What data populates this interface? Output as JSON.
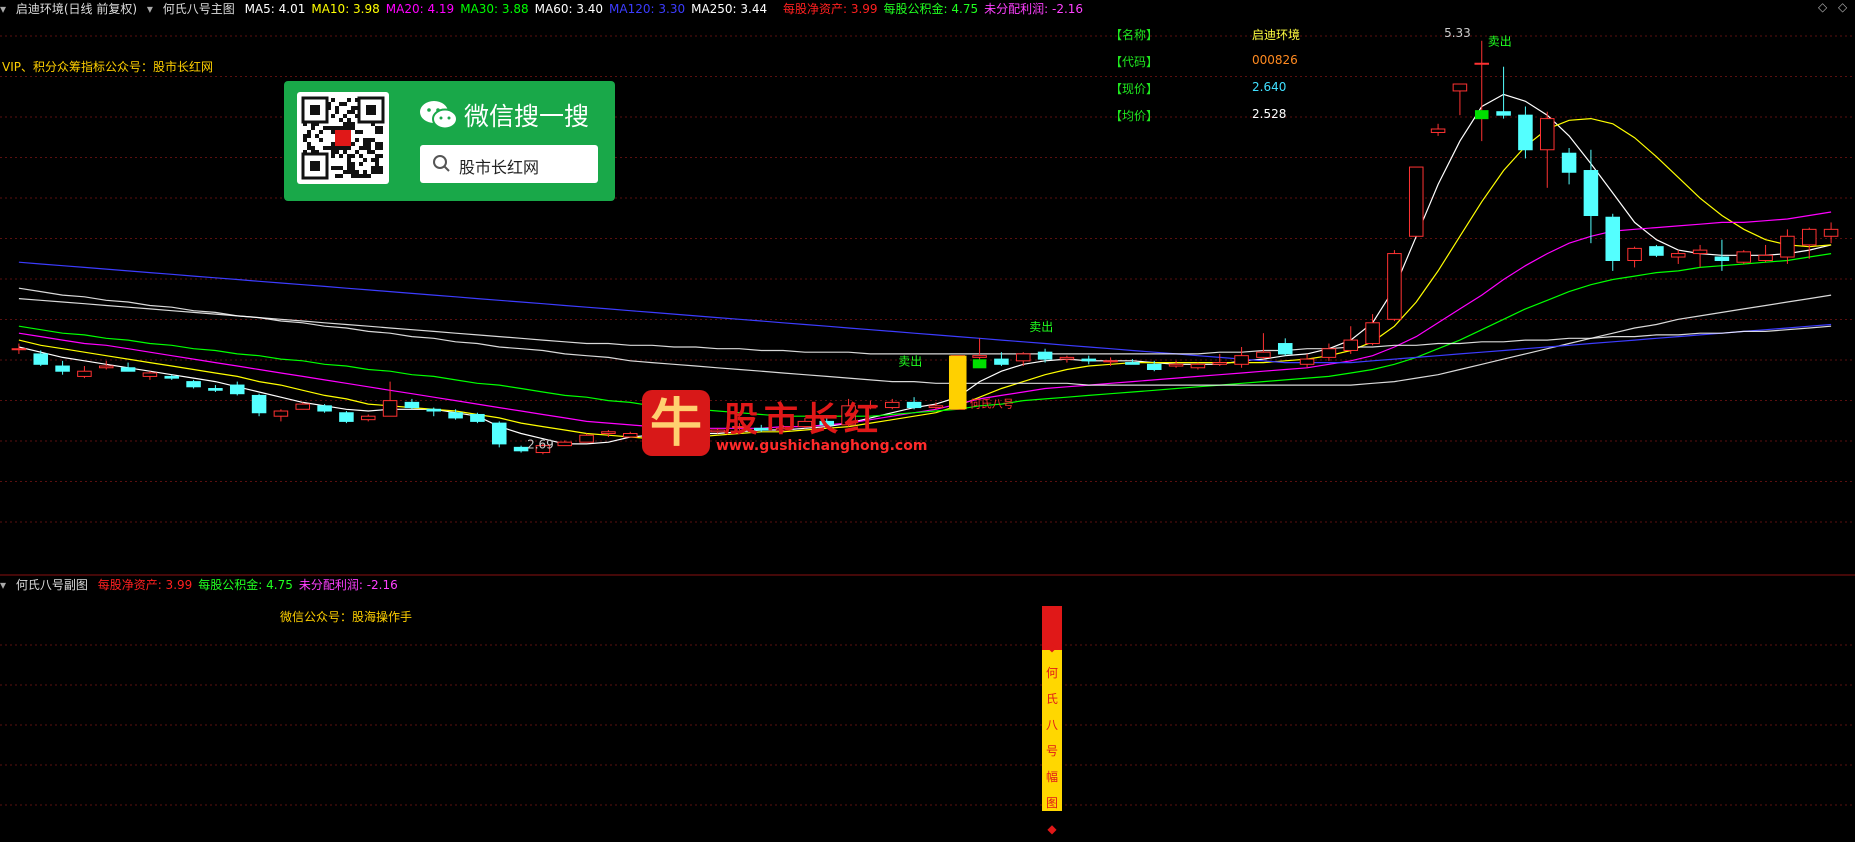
{
  "header": {
    "stock_title": "启迪环境(日线 前复权)",
    "indicator_name": "何氏八号主图",
    "ma_items": [
      {
        "label": "MA5: 4.01",
        "color": "#ffffff"
      },
      {
        "label": "MA10: 3.98",
        "color": "#ffff00"
      },
      {
        "label": "MA20: 4.19",
        "color": "#ff00ff"
      },
      {
        "label": "MA30: 3.88",
        "color": "#00ff00"
      },
      {
        "label": "MA60: 3.40",
        "color": "#ffffff"
      },
      {
        "label": "MA120: 3.30",
        "color": "#3c3cff"
      },
      {
        "label": "MA250: 3.44",
        "color": "#ffffff"
      }
    ],
    "fin_items": [
      {
        "label": "每股净资产: 3.99",
        "color": "#ff2020"
      },
      {
        "label": "每股公积金: 4.75",
        "color": "#20ff20"
      },
      {
        "label": "未分配利润: -2.16",
        "color": "#ff40ff"
      }
    ]
  },
  "vip_note": "VIP、积分众筹指标公众号：股市长红网",
  "info_panel": [
    {
      "key": "【名称】",
      "value": "启迪环境",
      "color": "#ffff40"
    },
    {
      "key": "【代码】",
      "value": "000826",
      "color": "#ff8a20"
    },
    {
      "key": "【现价】",
      "value": "2.640",
      "color": "#40e0ff"
    },
    {
      "key": "【均价】",
      "value": "2.528",
      "color": "#ffffff"
    }
  ],
  "wechat_box": {
    "title": "微信搜一搜",
    "search_text": "股市长红网"
  },
  "watermark": {
    "char": "牛",
    "name": "股市长红",
    "url": "www.gushichanghong.com"
  },
  "sub_chart": {
    "title": "何氏八号副图",
    "fin_items": [
      {
        "label": "每股净资产: 3.99",
        "color": "#ff2020"
      },
      {
        "label": "每股公积金: 4.75",
        "color": "#20ff20"
      },
      {
        "label": "未分配利润: -2.16",
        "color": "#ff40ff"
      }
    ],
    "note": "微信公众号：股海操作手",
    "vertical_text": [
      "◆",
      "何",
      "氏",
      "八",
      "号",
      "幅",
      "图",
      "◆"
    ]
  },
  "chart_data": {
    "type": "candlestick",
    "ylim": [
      2.3,
      5.45
    ],
    "colors": {
      "up": "#ff3232",
      "down": "#54ffff",
      "ma5": "#ffffff",
      "ma10": "#ffff00",
      "ma20": "#ff00ff",
      "ma30": "#00ff00",
      "ma60": "#ffffff",
      "ma120": "#3c3cff",
      "ma250": "#ffffff"
    },
    "candles": [
      {
        "o": 3.55,
        "h": 3.58,
        "l": 3.52,
        "c": 3.55
      },
      {
        "o": 3.52,
        "h": 3.54,
        "l": 3.45,
        "c": 3.46
      },
      {
        "o": 3.45,
        "h": 3.48,
        "l": 3.4,
        "c": 3.42
      },
      {
        "o": 3.39,
        "h": 3.45,
        "l": 3.38,
        "c": 3.42
      },
      {
        "o": 3.44,
        "h": 3.48,
        "l": 3.43,
        "c": 3.45
      },
      {
        "o": 3.44,
        "h": 3.47,
        "l": 3.42,
        "c": 3.42
      },
      {
        "o": 3.39,
        "h": 3.42,
        "l": 3.37,
        "c": 3.41
      },
      {
        "o": 3.39,
        "h": 3.4,
        "l": 3.37,
        "c": 3.38
      },
      {
        "o": 3.36,
        "h": 3.37,
        "l": 3.32,
        "c": 3.33
      },
      {
        "o": 3.32,
        "h": 3.34,
        "l": 3.3,
        "c": 3.31
      },
      {
        "o": 3.34,
        "h": 3.36,
        "l": 3.28,
        "c": 3.29
      },
      {
        "o": 3.28,
        "h": 3.29,
        "l": 3.16,
        "c": 3.18
      },
      {
        "o": 3.16,
        "h": 3.2,
        "l": 3.13,
        "c": 3.19
      },
      {
        "o": 3.2,
        "h": 3.24,
        "l": 3.2,
        "c": 3.23
      },
      {
        "o": 3.22,
        "h": 3.23,
        "l": 3.18,
        "c": 3.19
      },
      {
        "o": 3.18,
        "h": 3.19,
        "l": 3.12,
        "c": 3.13
      },
      {
        "o": 3.14,
        "h": 3.17,
        "l": 3.13,
        "c": 3.16
      },
      {
        "o": 3.16,
        "h": 3.36,
        "l": 3.16,
        "c": 3.25
      },
      {
        "o": 3.24,
        "h": 3.26,
        "l": 3.2,
        "c": 3.21
      },
      {
        "o": 3.2,
        "h": 3.21,
        "l": 3.16,
        "c": 3.19
      },
      {
        "o": 3.18,
        "h": 3.2,
        "l": 3.14,
        "c": 3.15
      },
      {
        "o": 3.17,
        "h": 3.18,
        "l": 3.12,
        "c": 3.13
      },
      {
        "o": 3.12,
        "h": 3.13,
        "l": 2.98,
        "c": 3.0
      },
      {
        "o": 2.98,
        "h": 2.99,
        "l": 2.95,
        "c": 2.96
      },
      {
        "o": 2.95,
        "h": 3.0,
        "l": 2.94,
        "c": 2.99
      },
      {
        "o": 2.99,
        "h": 3.02,
        "l": 2.99,
        "c": 3.01
      },
      {
        "o": 3.01,
        "h": 3.06,
        "l": 3.01,
        "c": 3.05
      },
      {
        "o": 3.06,
        "h": 3.08,
        "l": 3.04,
        "c": 3.07
      },
      {
        "o": 3.04,
        "h": 3.07,
        "l": 3.04,
        "c": 3.06
      },
      {
        "o": 3.04,
        "h": 3.06,
        "l": 3.03,
        "c": 3.05
      },
      {
        "o": 3.06,
        "h": 3.08,
        "l": 3.05,
        "c": 3.06
      },
      {
        "o": 3.06,
        "h": 3.1,
        "l": 3.06,
        "c": 3.08
      },
      {
        "o": 3.07,
        "h": 3.09,
        "l": 3.06,
        "c": 3.08
      },
      {
        "o": 3.1,
        "h": 3.12,
        "l": 3.08,
        "c": 3.1
      },
      {
        "o": 3.09,
        "h": 3.11,
        "l": 3.07,
        "c": 3.08
      },
      {
        "o": 3.08,
        "h": 3.11,
        "l": 3.07,
        "c": 3.09
      },
      {
        "o": 3.1,
        "h": 3.15,
        "l": 3.09,
        "c": 3.13
      },
      {
        "o": 3.13,
        "h": 3.15,
        "l": 3.1,
        "c": 3.11
      },
      {
        "o": 3.11,
        "h": 3.26,
        "l": 3.1,
        "c": 3.22
      },
      {
        "o": 3.22,
        "h": 3.25,
        "l": 3.2,
        "c": 3.22
      },
      {
        "o": 3.21,
        "h": 3.26,
        "l": 3.2,
        "c": 3.24
      },
      {
        "o": 3.24,
        "h": 3.27,
        "l": 3.2,
        "c": 3.21
      },
      {
        "o": 3.21,
        "h": 3.24,
        "l": 3.2,
        "c": 3.22
      },
      {
        "o": 3.2,
        "h": 3.51,
        "l": 3.2,
        "c": 3.51
      },
      {
        "o": 3.5,
        "h": 3.61,
        "l": 3.44,
        "c": 3.51
      },
      {
        "o": 3.49,
        "h": 3.53,
        "l": 3.45,
        "c": 3.46
      },
      {
        "o": 3.48,
        "h": 3.53,
        "l": 3.45,
        "c": 3.52
      },
      {
        "o": 3.53,
        "h": 3.55,
        "l": 3.47,
        "c": 3.49
      },
      {
        "o": 3.49,
        "h": 3.51,
        "l": 3.47,
        "c": 3.5
      },
      {
        "o": 3.49,
        "h": 3.51,
        "l": 3.46,
        "c": 3.48
      },
      {
        "o": 3.48,
        "h": 3.5,
        "l": 3.45,
        "c": 3.48
      },
      {
        "o": 3.47,
        "h": 3.49,
        "l": 3.46,
        "c": 3.46
      },
      {
        "o": 3.46,
        "h": 3.48,
        "l": 3.42,
        "c": 3.43
      },
      {
        "o": 3.45,
        "h": 3.48,
        "l": 3.44,
        "c": 3.46
      },
      {
        "o": 3.44,
        "h": 3.47,
        "l": 3.43,
        "c": 3.46
      },
      {
        "o": 3.46,
        "h": 3.52,
        "l": 3.45,
        "c": 3.47
      },
      {
        "o": 3.46,
        "h": 3.56,
        "l": 3.44,
        "c": 3.51
      },
      {
        "o": 3.5,
        "h": 3.64,
        "l": 3.49,
        "c": 3.53
      },
      {
        "o": 3.58,
        "h": 3.61,
        "l": 3.51,
        "c": 3.52
      },
      {
        "o": 3.46,
        "h": 3.52,
        "l": 3.44,
        "c": 3.49
      },
      {
        "o": 3.5,
        "h": 3.58,
        "l": 3.48,
        "c": 3.55
      },
      {
        "o": 3.54,
        "h": 3.68,
        "l": 3.52,
        "c": 3.6
      },
      {
        "o": 3.58,
        "h": 3.75,
        "l": 3.57,
        "c": 3.7
      },
      {
        "o": 3.72,
        "h": 4.12,
        "l": 3.71,
        "c": 4.1
      },
      {
        "o": 4.2,
        "h": 4.6,
        "l": 4.2,
        "c": 4.6
      },
      {
        "o": 4.8,
        "h": 4.85,
        "l": 4.78,
        "c": 4.82
      },
      {
        "o": 5.04,
        "h": 5.08,
        "l": 4.9,
        "c": 5.08
      },
      {
        "o": 5.2,
        "h": 5.33,
        "l": 4.75,
        "c": 5.2
      },
      {
        "o": 4.92,
        "h": 5.18,
        "l": 4.88,
        "c": 4.9
      },
      {
        "o": 4.9,
        "h": 4.95,
        "l": 4.65,
        "c": 4.7
      },
      {
        "o": 4.7,
        "h": 4.92,
        "l": 4.48,
        "c": 4.88
      },
      {
        "o": 4.68,
        "h": 4.71,
        "l": 4.5,
        "c": 4.57
      },
      {
        "o": 4.58,
        "h": 4.7,
        "l": 4.16,
        "c": 4.32
      },
      {
        "o": 4.31,
        "h": 4.33,
        "l": 4.0,
        "c": 4.06
      },
      {
        "o": 4.06,
        "h": 4.14,
        "l": 4.02,
        "c": 4.13
      },
      {
        "o": 4.14,
        "h": 4.15,
        "l": 4.08,
        "c": 4.09
      },
      {
        "o": 4.08,
        "h": 4.12,
        "l": 4.04,
        "c": 4.1
      },
      {
        "o": 4.1,
        "h": 4.15,
        "l": 4.02,
        "c": 4.12
      },
      {
        "o": 4.08,
        "h": 4.18,
        "l": 4.0,
        "c": 4.06
      },
      {
        "o": 4.05,
        "h": 4.12,
        "l": 4.04,
        "c": 4.11
      },
      {
        "o": 4.06,
        "h": 4.15,
        "l": 4.05,
        "c": 4.09
      },
      {
        "o": 4.08,
        "h": 4.24,
        "l": 4.04,
        "c": 4.2
      },
      {
        "o": 4.15,
        "h": 4.25,
        "l": 4.07,
        "c": 4.24
      },
      {
        "o": 4.2,
        "h": 4.28,
        "l": 4.16,
        "c": 4.24
      }
    ],
    "ma": {
      "ma5": [
        3.56,
        3.53,
        3.5,
        3.48,
        3.46,
        3.44,
        3.42,
        3.4,
        3.38,
        3.36,
        3.33,
        3.3,
        3.27,
        3.24,
        3.22,
        3.2,
        3.19,
        3.2,
        3.2,
        3.2,
        3.18,
        3.16,
        3.1,
        3.06,
        3.03,
        3.0,
        3.0,
        3.01,
        3.04,
        3.05,
        3.06,
        3.06,
        3.06,
        3.07,
        3.08,
        3.08,
        3.09,
        3.1,
        3.12,
        3.15,
        3.18,
        3.21,
        3.23,
        3.27,
        3.36,
        3.42,
        3.46,
        3.48,
        3.49,
        3.48,
        3.48,
        3.48,
        3.47,
        3.46,
        3.46,
        3.46,
        3.48,
        3.49,
        3.51,
        3.52,
        3.55,
        3.6,
        3.7,
        3.9,
        4.2,
        4.5,
        4.75,
        4.95,
        5.02,
        4.98,
        4.9,
        4.78,
        4.62,
        4.45,
        4.28,
        4.18,
        4.12,
        4.1,
        4.09,
        4.09,
        4.09,
        4.1,
        4.12,
        4.15
      ],
      "ma10": [
        3.6,
        3.57,
        3.55,
        3.53,
        3.51,
        3.49,
        3.47,
        3.45,
        3.43,
        3.41,
        3.39,
        3.36,
        3.34,
        3.31,
        3.28,
        3.26,
        3.23,
        3.22,
        3.21,
        3.2,
        3.19,
        3.17,
        3.15,
        3.12,
        3.1,
        3.08,
        3.06,
        3.05,
        3.04,
        3.03,
        3.03,
        3.04,
        3.05,
        3.06,
        3.07,
        3.07,
        3.08,
        3.09,
        3.1,
        3.12,
        3.14,
        3.16,
        3.18,
        3.22,
        3.27,
        3.32,
        3.36,
        3.4,
        3.43,
        3.45,
        3.46,
        3.47,
        3.47,
        3.47,
        3.47,
        3.47,
        3.47,
        3.47,
        3.48,
        3.49,
        3.51,
        3.54,
        3.59,
        3.68,
        3.82,
        4.0,
        4.2,
        4.4,
        4.58,
        4.72,
        4.82,
        4.87,
        4.88,
        4.85,
        4.77,
        4.66,
        4.54,
        4.42,
        4.32,
        4.24,
        4.18,
        4.15,
        4.14,
        4.15
      ],
      "ma20": [
        3.64,
        3.62,
        3.6,
        3.58,
        3.57,
        3.55,
        3.53,
        3.51,
        3.49,
        3.47,
        3.45,
        3.43,
        3.41,
        3.39,
        3.37,
        3.35,
        3.33,
        3.31,
        3.29,
        3.27,
        3.25,
        3.23,
        3.21,
        3.19,
        3.17,
        3.15,
        3.13,
        3.12,
        3.11,
        3.1,
        3.09,
        3.09,
        3.09,
        3.09,
        3.09,
        3.1,
        3.1,
        3.11,
        3.12,
        3.14,
        3.16,
        3.18,
        3.2,
        3.23,
        3.26,
        3.28,
        3.3,
        3.32,
        3.33,
        3.34,
        3.35,
        3.36,
        3.37,
        3.38,
        3.39,
        3.4,
        3.41,
        3.42,
        3.43,
        3.44,
        3.46,
        3.48,
        3.51,
        3.56,
        3.62,
        3.7,
        3.78,
        3.86,
        3.95,
        4.03,
        4.1,
        4.16,
        4.2,
        4.23,
        4.24,
        4.25,
        4.26,
        4.27,
        4.28,
        4.28,
        4.29,
        4.3,
        4.32,
        4.34
      ],
      "ma30": [
        3.68,
        3.66,
        3.64,
        3.63,
        3.61,
        3.6,
        3.58,
        3.57,
        3.55,
        3.54,
        3.52,
        3.51,
        3.49,
        3.48,
        3.46,
        3.45,
        3.43,
        3.42,
        3.4,
        3.39,
        3.37,
        3.35,
        3.34,
        3.32,
        3.3,
        3.28,
        3.27,
        3.25,
        3.24,
        3.22,
        3.21,
        3.2,
        3.19,
        3.18,
        3.17,
        3.16,
        3.16,
        3.16,
        3.16,
        3.16,
        3.17,
        3.18,
        3.19,
        3.2,
        3.22,
        3.23,
        3.25,
        3.26,
        3.27,
        3.28,
        3.29,
        3.3,
        3.31,
        3.32,
        3.33,
        3.34,
        3.35,
        3.36,
        3.37,
        3.38,
        3.39,
        3.41,
        3.43,
        3.46,
        3.5,
        3.55,
        3.6,
        3.66,
        3.72,
        3.78,
        3.83,
        3.88,
        3.92,
        3.95,
        3.97,
        3.99,
        4.0,
        4.02,
        4.03,
        4.04,
        4.05,
        4.06,
        4.08,
        4.1
      ],
      "ma60": [
        3.9,
        3.88,
        3.86,
        3.85,
        3.83,
        3.82,
        3.8,
        3.79,
        3.77,
        3.76,
        3.74,
        3.73,
        3.71,
        3.7,
        3.68,
        3.67,
        3.65,
        3.64,
        3.62,
        3.61,
        3.59,
        3.58,
        3.56,
        3.55,
        3.54,
        3.52,
        3.51,
        3.5,
        3.48,
        3.47,
        3.46,
        3.45,
        3.44,
        3.43,
        3.42,
        3.41,
        3.4,
        3.39,
        3.38,
        3.37,
        3.36,
        3.36,
        3.35,
        3.35,
        3.35,
        3.35,
        3.35,
        3.35,
        3.35,
        3.34,
        3.34,
        3.34,
        3.34,
        3.34,
        3.34,
        3.34,
        3.34,
        3.34,
        3.34,
        3.34,
        3.34,
        3.34,
        3.35,
        3.36,
        3.38,
        3.4,
        3.43,
        3.46,
        3.49,
        3.52,
        3.55,
        3.58,
        3.61,
        3.64,
        3.67,
        3.69,
        3.72,
        3.74,
        3.76,
        3.78,
        3.8,
        3.82,
        3.84,
        3.86
      ],
      "ma120": [
        4.05,
        4.04,
        4.03,
        4.02,
        4.01,
        4.0,
        3.99,
        3.98,
        3.97,
        3.96,
        3.95,
        3.94,
        3.93,
        3.92,
        3.91,
        3.9,
        3.89,
        3.88,
        3.87,
        3.86,
        3.85,
        3.84,
        3.83,
        3.82,
        3.81,
        3.8,
        3.79,
        3.78,
        3.77,
        3.76,
        3.75,
        3.74,
        3.73,
        3.72,
        3.71,
        3.7,
        3.69,
        3.68,
        3.67,
        3.66,
        3.65,
        3.64,
        3.63,
        3.62,
        3.61,
        3.6,
        3.59,
        3.58,
        3.57,
        3.56,
        3.55,
        3.54,
        3.53,
        3.52,
        3.51,
        3.5,
        3.49,
        3.48,
        3.47,
        3.47,
        3.47,
        3.47,
        3.48,
        3.49,
        3.5,
        3.51,
        3.52,
        3.53,
        3.54,
        3.55,
        3.56,
        3.57,
        3.58,
        3.59,
        3.6,
        3.61,
        3.62,
        3.63,
        3.64,
        3.65,
        3.66,
        3.67,
        3.68,
        3.69
      ],
      "ma250": [
        3.84,
        3.83,
        3.82,
        3.81,
        3.8,
        3.79,
        3.78,
        3.77,
        3.76,
        3.75,
        3.74,
        3.73,
        3.72,
        3.71,
        3.7,
        3.69,
        3.68,
        3.67,
        3.66,
        3.65,
        3.64,
        3.63,
        3.62,
        3.61,
        3.6,
        3.59,
        3.58,
        3.58,
        3.57,
        3.57,
        3.56,
        3.56,
        3.55,
        3.55,
        3.54,
        3.54,
        3.53,
        3.53,
        3.53,
        3.52,
        3.52,
        3.52,
        3.52,
        3.52,
        3.52,
        3.52,
        3.52,
        3.52,
        3.52,
        3.52,
        3.52,
        3.52,
        3.52,
        3.52,
        3.52,
        3.53,
        3.53,
        3.54,
        3.54,
        3.55,
        3.55,
        3.56,
        3.56,
        3.57,
        3.57,
        3.58,
        3.58,
        3.59,
        3.59,
        3.6,
        3.6,
        3.61,
        3.61,
        3.62,
        3.62,
        3.63,
        3.63,
        3.64,
        3.64,
        3.65,
        3.65,
        3.66,
        3.67,
        3.68
      ]
    },
    "annotations": [
      {
        "text": "卖出",
        "index": 40,
        "price": 3.43,
        "color": "#20ff20"
      },
      {
        "text": "卖出",
        "index": 46,
        "price": 3.63,
        "color": "#20ff20"
      },
      {
        "text": "卖出",
        "index": 67,
        "price": 5.28,
        "color": "#20ff20"
      },
      {
        "text": "5.33",
        "index": 65,
        "price": 5.33,
        "color": "#cccccc"
      },
      {
        "text": "2.69",
        "index": 23,
        "price": 2.95,
        "color": "#cccccc"
      }
    ],
    "marker_label": "何氏八号"
  }
}
